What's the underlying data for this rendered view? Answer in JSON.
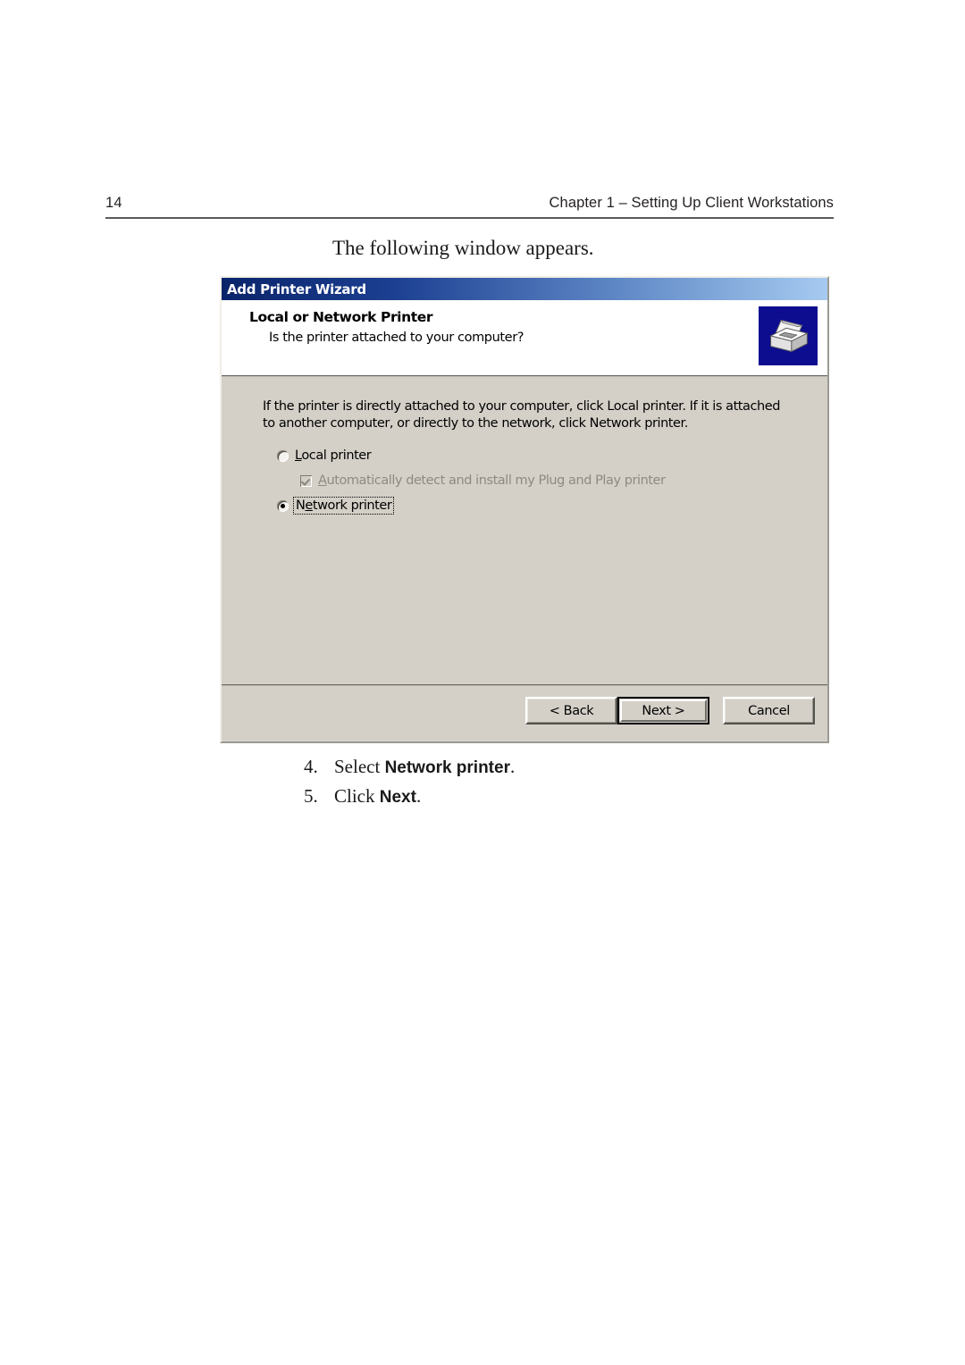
{
  "page": {
    "number": "14",
    "chapter_header": "Chapter 1 – Setting Up Client Workstations",
    "intro_line": "The following window appears."
  },
  "dialog": {
    "titlebar": {
      "title": "Add Printer Wizard",
      "gradient_start": "#0a246a",
      "gradient_end": "#a6caf0"
    },
    "header": {
      "heading": "Local or Network Printer",
      "subheading": "Is the printer attached to your computer?",
      "icon": "printer-icon",
      "icon_background": "#000070"
    },
    "body": {
      "instruction": "If the printer is directly attached to your computer, click Local printer.  If it is attached to another computer, or directly to the network, click Network printer.",
      "options": [
        {
          "name": "local-printer",
          "control": "radio",
          "label_prefix": "",
          "accelerator": "L",
          "label_suffix": "ocal printer",
          "checked": false,
          "disabled": false,
          "focused": false
        },
        {
          "name": "auto-detect-plug-and-play",
          "control": "checkbox",
          "label_prefix": "",
          "accelerator": "A",
          "label_suffix": "utomatically detect and install my Plug and Play printer",
          "checked": true,
          "disabled": true,
          "focused": false
        },
        {
          "name": "network-printer",
          "control": "radio",
          "label_prefix": "N",
          "accelerator": "e",
          "label_suffix": "twork printer",
          "checked": true,
          "disabled": false,
          "focused": true
        }
      ]
    },
    "buttons": [
      {
        "name": "back-button",
        "label": "< Back",
        "default": false
      },
      {
        "name": "next-button",
        "label": "Next >",
        "default": true
      },
      {
        "name": "cancel-button",
        "label": "Cancel",
        "default": false
      }
    ]
  },
  "steps": [
    {
      "number": "4.",
      "text_before": "Select ",
      "bold": "Network printer",
      "text_after": "."
    },
    {
      "number": "5.",
      "text_before": "Click ",
      "bold": "Next",
      "text_after": "."
    }
  ]
}
